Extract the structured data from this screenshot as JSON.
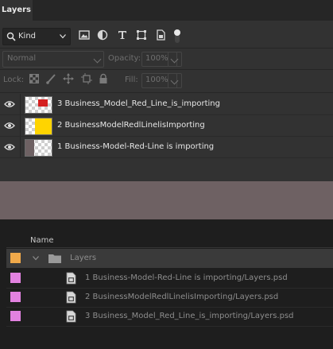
{
  "panel": {
    "tab_label": "Layers",
    "filter": {
      "kind_label": "Kind",
      "icons": [
        "pixel-layer-filter-icon",
        "adjustment-layer-filter-icon",
        "type-layer-filter-icon",
        "shape-layer-filter-icon",
        "smart-object-filter-icon",
        "filter-toggle-icon"
      ]
    },
    "blend_mode": "Normal",
    "opacity_label": "Opacity:",
    "opacity_value": "100%",
    "lock_label": "Lock:",
    "lock_icons": [
      "lock-transparent-pixels-icon",
      "lock-image-pixels-icon",
      "lock-position-icon",
      "lock-artboard-icon",
      "lock-all-icon"
    ],
    "fill_label": "Fill:",
    "fill_value": "100%"
  },
  "layers": [
    {
      "name": "3 Business_Model_Red_Line_is_importing",
      "thumb_color": "#d42020",
      "thumb": "red-square"
    },
    {
      "name": "2 BusinessModelRedlLinelisImporting",
      "thumb_color": "#ffd400",
      "thumb": "yellow-fill"
    },
    {
      "name": "1 Business-Model-Red-Line is importing",
      "thumb_color": "#6e6163",
      "thumb": "mauve-fill"
    }
  ],
  "canvas_color": "#6e6163",
  "finder": {
    "column_header": "Name",
    "folder": {
      "name": "Layers",
      "tag_color": "#f0a94a"
    },
    "files": [
      {
        "name": "1 Business-Model-Red-Line is importing/Layers.psd",
        "tag_color": "#e282e0"
      },
      {
        "name": "2 BusinessModelRedlLinelisImporting/Layers.psd",
        "tag_color": "#e282e0"
      },
      {
        "name": "3 Business_Model_Red_Line_is_importing/Layers.psd",
        "tag_color": "#e282e0"
      }
    ]
  }
}
